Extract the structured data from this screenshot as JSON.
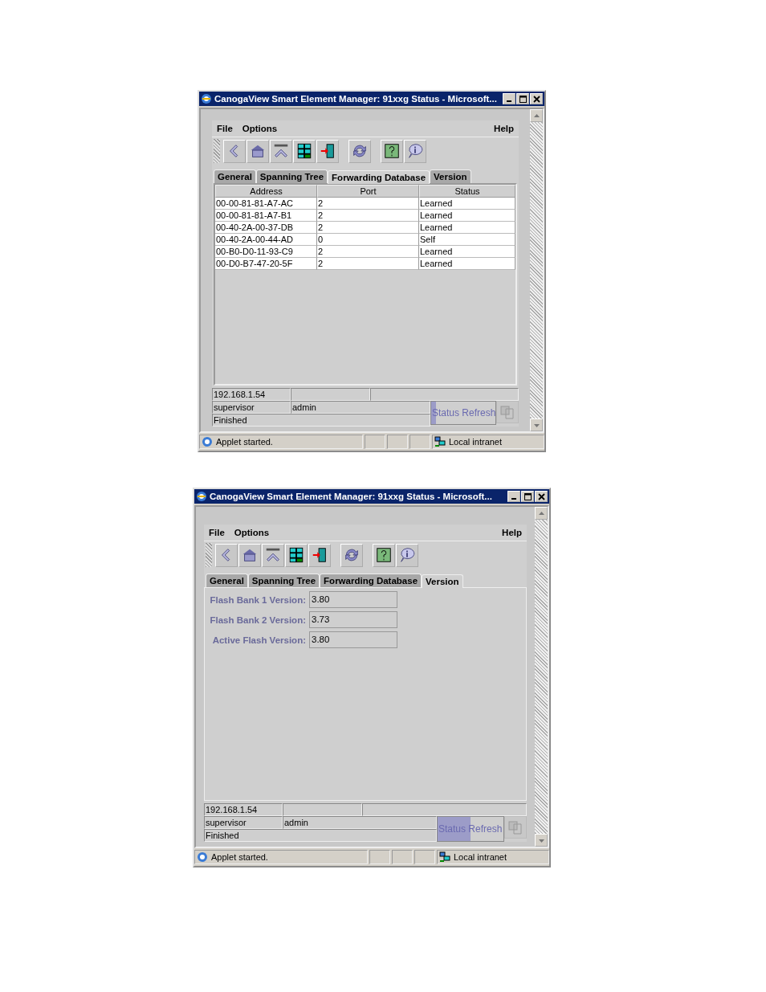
{
  "windows": [
    {
      "title": "CanogaView Smart Element Manager: 91xxg Status - Microsoft...",
      "menu": {
        "left": [
          "File",
          "Options"
        ],
        "right": "Help"
      },
      "tabs": [
        {
          "label": "General",
          "selected": false
        },
        {
          "label": "Spanning Tree",
          "selected": false
        },
        {
          "label": "Forwarding Database",
          "selected": true
        },
        {
          "label": "Version",
          "selected": false
        }
      ],
      "content": {
        "kind": "table",
        "columns": [
          "Address",
          "Port",
          "Status"
        ],
        "rows": [
          [
            "00-00-81-81-A7-AC",
            "2",
            "Learned"
          ],
          [
            "00-00-81-81-A7-B1",
            "2",
            "Learned"
          ],
          [
            "00-40-2A-00-37-DB",
            "2",
            "Learned"
          ],
          [
            "00-40-2A-00-44-AD",
            "0",
            "Self"
          ],
          [
            "00-B0-D0-11-93-C9",
            "2",
            "Learned"
          ],
          [
            "00-D0-B7-47-20-5F",
            "2",
            "Learned"
          ]
        ]
      },
      "status": {
        "address": "192.168.1.54",
        "user": "supervisor",
        "role": "admin",
        "message": "Finished",
        "refresh": {
          "label": "Status Refresh",
          "level": 0.08
        }
      },
      "browser_status": {
        "text": "Applet started.",
        "zone": "Local intranet"
      }
    },
    {
      "title": "CanogaView Smart Element Manager: 91xxg Status - Microsoft...",
      "menu": {
        "left": [
          "File",
          "Options"
        ],
        "right": "Help"
      },
      "tabs": [
        {
          "label": "General",
          "selected": false
        },
        {
          "label": "Spanning Tree",
          "selected": false
        },
        {
          "label": "Forwarding Database",
          "selected": false
        },
        {
          "label": "Version",
          "selected": true
        }
      ],
      "content": {
        "kind": "form",
        "fields": [
          {
            "label": "Flash Bank 1 Version:",
            "value": "3.80"
          },
          {
            "label": "Flash Bank 2 Version:",
            "value": "3.73"
          },
          {
            "label": "Active Flash Version:",
            "value": "3.80"
          }
        ]
      },
      "status": {
        "address": "192.168.1.54",
        "user": "supervisor",
        "role": "admin",
        "message": "Finished",
        "refresh": {
          "label": "Status Refresh",
          "level": 0.5
        }
      },
      "browser_status": {
        "text": "Applet started.",
        "zone": "Local intranet"
      }
    }
  ]
}
